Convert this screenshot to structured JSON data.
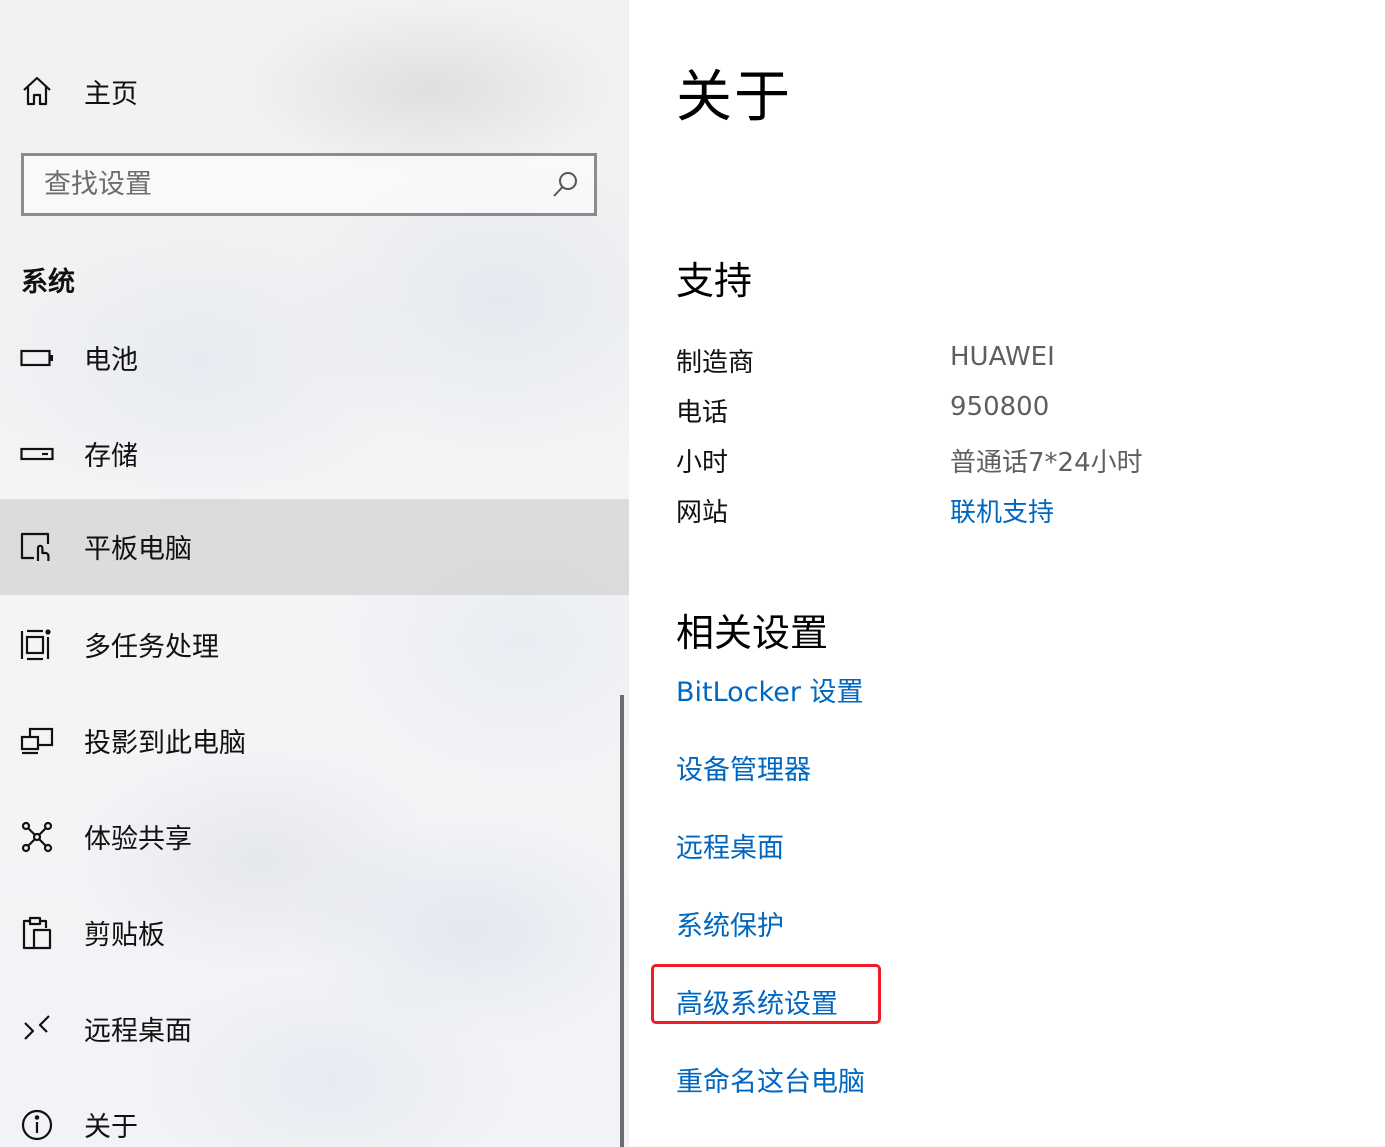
{
  "sidebar": {
    "home_label": "主页",
    "search_placeholder": "查找设置",
    "section_title": "系统",
    "items": [
      {
        "label": "电池",
        "icon": "battery-icon"
      },
      {
        "label": "存储",
        "icon": "storage-icon"
      },
      {
        "label": "平板电脑",
        "icon": "tablet-icon",
        "selected": true
      },
      {
        "label": "多任务处理",
        "icon": "multitasking-icon"
      },
      {
        "label": "投影到此电脑",
        "icon": "project-icon"
      },
      {
        "label": "体验共享",
        "icon": "shared-experiences-icon"
      },
      {
        "label": "剪贴板",
        "icon": "clipboard-icon"
      },
      {
        "label": "远程桌面",
        "icon": "remote-desktop-icon"
      },
      {
        "label": "关于",
        "icon": "info-icon"
      }
    ]
  },
  "main": {
    "title": "关于",
    "support": {
      "heading": "支持",
      "rows": [
        {
          "key": "制造商",
          "value": "HUAWEI"
        },
        {
          "key": "电话",
          "value": "950800"
        },
        {
          "key": "小时",
          "value": "普通话7*24小时"
        },
        {
          "key": "网站",
          "value": "联机支持"
        }
      ]
    },
    "related": {
      "heading": "相关设置",
      "links": [
        "BitLocker 设置",
        "设备管理器",
        "远程桌面",
        "系统保护",
        "高级系统设置",
        "重命名这台电脑"
      ]
    }
  },
  "colors": {
    "link": "#0067c0",
    "highlight": "#ee1c25",
    "selected_bg": "#d2d2d2"
  }
}
